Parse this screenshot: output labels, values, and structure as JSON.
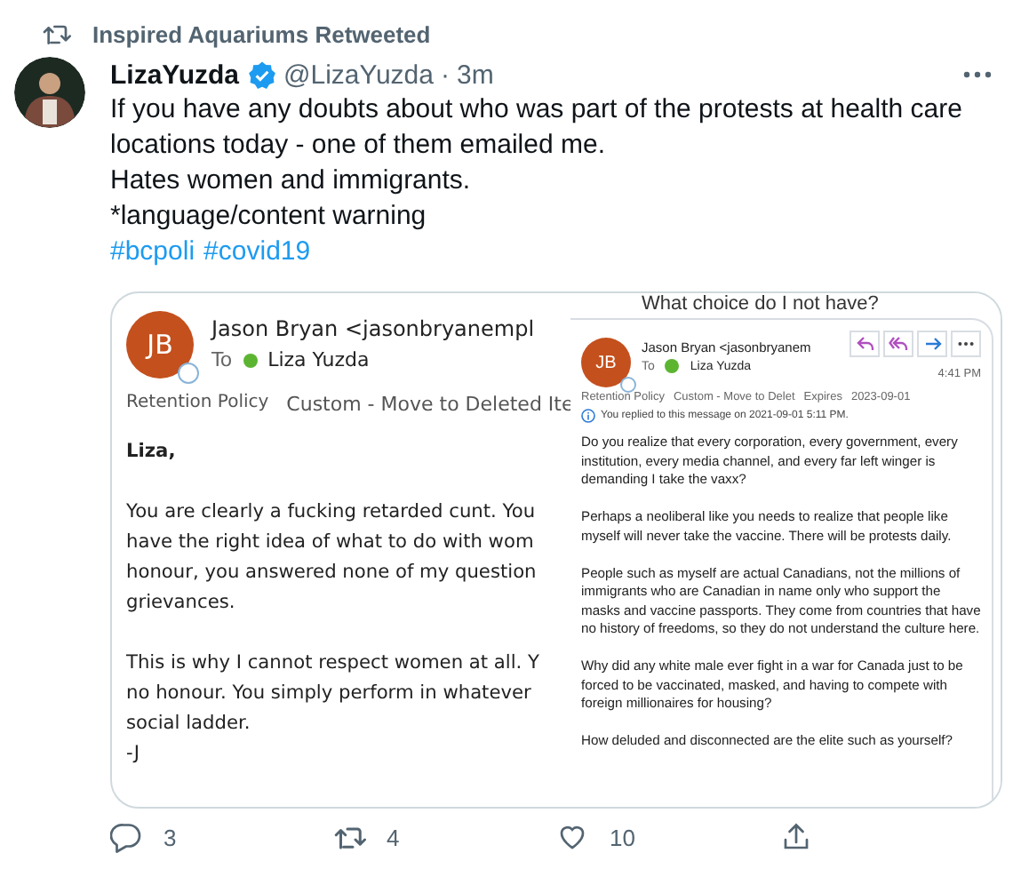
{
  "retweet_banner": {
    "text": "Inspired Aquariums Retweeted"
  },
  "tweet": {
    "display_name": "LizaYuzda",
    "verified": true,
    "handle": "@LizaYuzda",
    "separator": "·",
    "time": "3m",
    "lines": [
      "If you have any doubts about who was part of the protests at health care locations today - one of them emailed me.",
      "Hates women and immigrants.",
      "*language/content warning"
    ],
    "hashtags": [
      "#bcpoli",
      "#covid19"
    ]
  },
  "media": {
    "left_email": {
      "initials": "JB",
      "sender": "Jason Bryan <jasonbryanempl",
      "to_label": "To",
      "recipient": "Liza Yuzda",
      "policy_label": "Retention Policy",
      "policy": "Custom - Move to Deleted Ite",
      "paragraphs": [
        [
          "Liza,"
        ],
        [
          "You are clearly a fucking retarded cunt. You",
          "have the right idea of what to do with wom",
          "honour, you answered none of my question",
          "grievances."
        ],
        [
          "This is why I cannot respect women at all. Y",
          "no honour. You simply perform in whatever",
          "social ladder.",
          "-J"
        ]
      ]
    },
    "right_email": {
      "subject": "What choice do I not have?",
      "initials": "JB",
      "sender": "Jason Bryan <jasonbryanem",
      "to_label": "To",
      "recipient": "Liza Yuzda",
      "time": "4:41 PM",
      "policy_label": "Retention Policy",
      "policy": "Custom - Move to Delet",
      "expires_label": "Expires",
      "expires": "2023-09-01",
      "notice": "You replied to this message on 2021-09-01 5:11 PM.",
      "paragraphs": [
        "Do you realize that every corporation, every government, every institution, every media channel, and every far left winger is demanding I take the vaxx?",
        "Perhaps a neoliberal like you needs to realize that people like myself will never take the vaccine. There will be protests daily.",
        "People such as myself are actual Canadians, not the millions of immigrants who are Canadian in name only who support the masks and vaccine passports. They come from countries that have no history of freedoms, so they do not understand the culture here.",
        "Why did any white male ever fight in a war for Canada just to be forced to be vaccinated, masked, and having to compete with foreign millionaires for housing?",
        "How deluded and disconnected are the elite such as yourself?"
      ]
    }
  },
  "actions": [
    {
      "kind": "reply",
      "count": "3"
    },
    {
      "kind": "retweet",
      "count": "4"
    },
    {
      "kind": "like",
      "count": "10"
    },
    {
      "kind": "share"
    }
  ]
}
